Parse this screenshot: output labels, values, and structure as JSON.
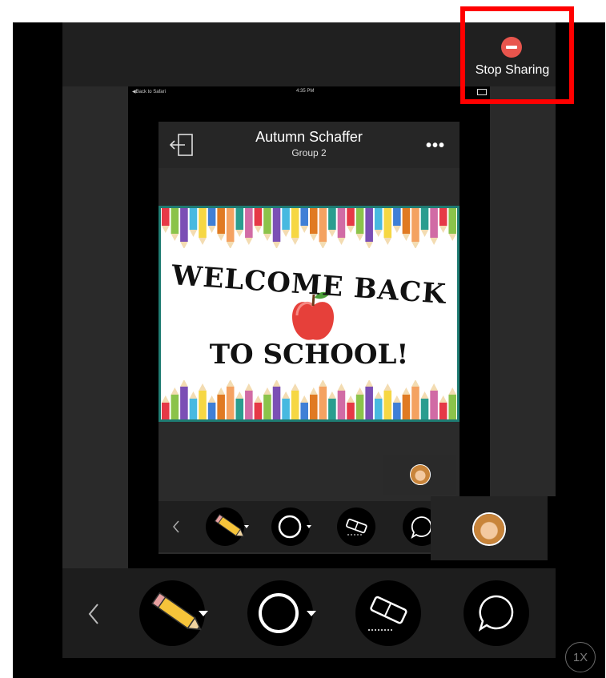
{
  "sharing": {
    "stop_label": "Stop Sharing"
  },
  "status_bar": {
    "back_text": "◀Back to Safari",
    "time": "4:35 PM"
  },
  "header": {
    "title": "Autumn Schaffer",
    "subtitle": "Group 2"
  },
  "content_card": {
    "line1": "WELCOME BACK",
    "line2": "TO SCHOOL!"
  },
  "zoom": {
    "label": "1X"
  },
  "colors": {
    "stop_red": "#e8554d",
    "highlight_border": "#ff0000",
    "card_border": "#1f7b72"
  },
  "icons": [
    "exit-icon",
    "more-icon",
    "pencil-tool-icon",
    "circle-tool-icon",
    "eraser-tool-icon",
    "comment-icon",
    "chevron-left-icon",
    "stop-sharing-icon",
    "avatar"
  ]
}
